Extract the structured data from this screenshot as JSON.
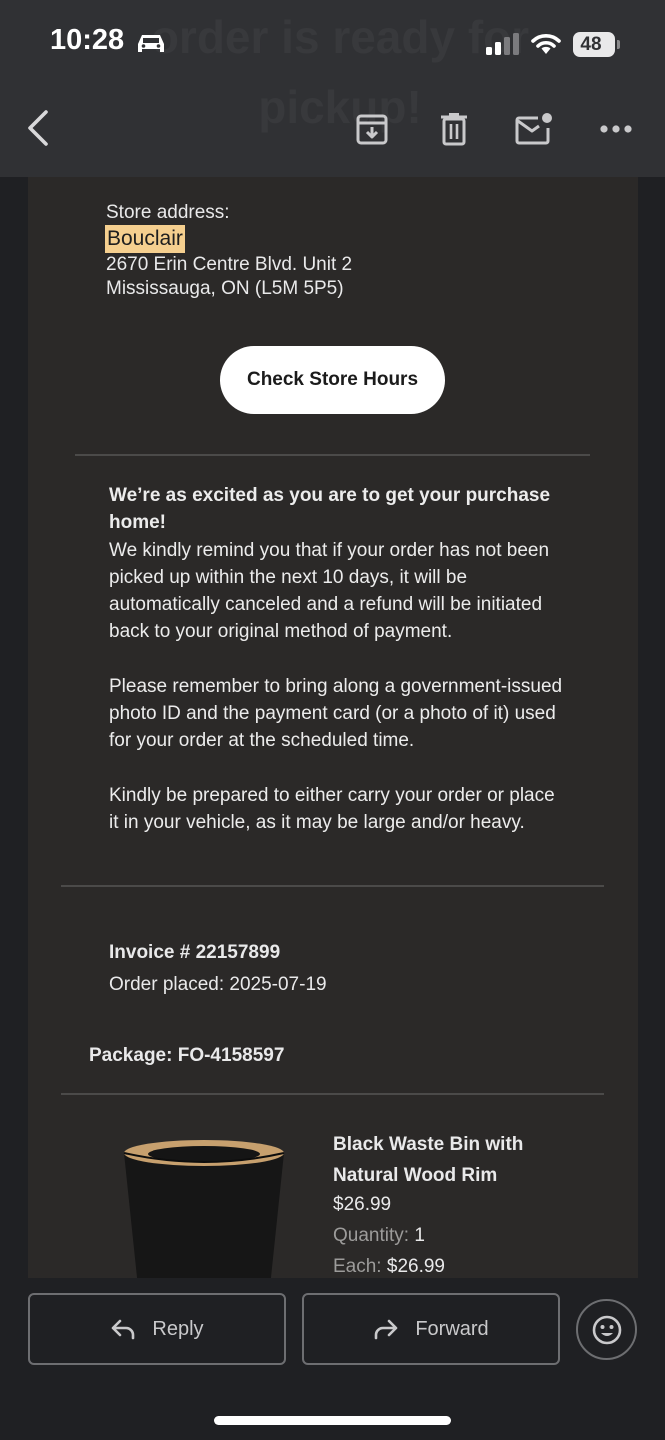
{
  "status_bar": {
    "time": "10:28",
    "battery": "48"
  },
  "header": {
    "background_title": "order is ready for pickup!"
  },
  "icons": {
    "back": "back-arrow-icon",
    "archive": "archive-icon",
    "delete": "trash-icon",
    "mark_unread": "mark-unread-icon",
    "more": "more-icon",
    "reply": "reply-arrow-icon",
    "forward": "forward-arrow-icon",
    "emoji": "emoji-icon"
  },
  "email": {
    "store_label": "Store address:",
    "store_name": "Bouclair",
    "address_line1": "2670 Erin Centre Blvd. Unit 2",
    "address_line2": "Mississauga, ON (L5M 5P5)",
    "check_hours_label": "Check Store Hours",
    "notice_heading": "We’re as excited as you are to get your purchase home!",
    "notice_body": "We kindly remind you that if your order has not been picked up within the next 10 days, it will be automatically canceled and a refund will be initiated back to your original method of payment.",
    "id_reminder": "Please remember to bring along a government-issued photo ID and the payment card (or a photo of it) used for your order at the scheduled time.",
    "carry_reminder": "Kindly be prepared to either carry your order or place it in your vehicle, as it may be large and/or heavy.",
    "invoice": "Invoice # 22157899",
    "order_placed": "Order placed: 2025-07-19",
    "package": "Package: FO-4158597",
    "product": {
      "name": "Black Waste Bin with Natural Wood Rim",
      "price": "$26.99",
      "quantity_label": "Quantity:",
      "quantity": "1",
      "each_label": "Each:",
      "each_price": "$26.99"
    }
  },
  "actions": {
    "reply": "Reply",
    "forward": "Forward"
  },
  "colors": {
    "highlight": "#f5cf8f",
    "card_bg": "#2b2928",
    "topbar_bg": "#303134"
  }
}
